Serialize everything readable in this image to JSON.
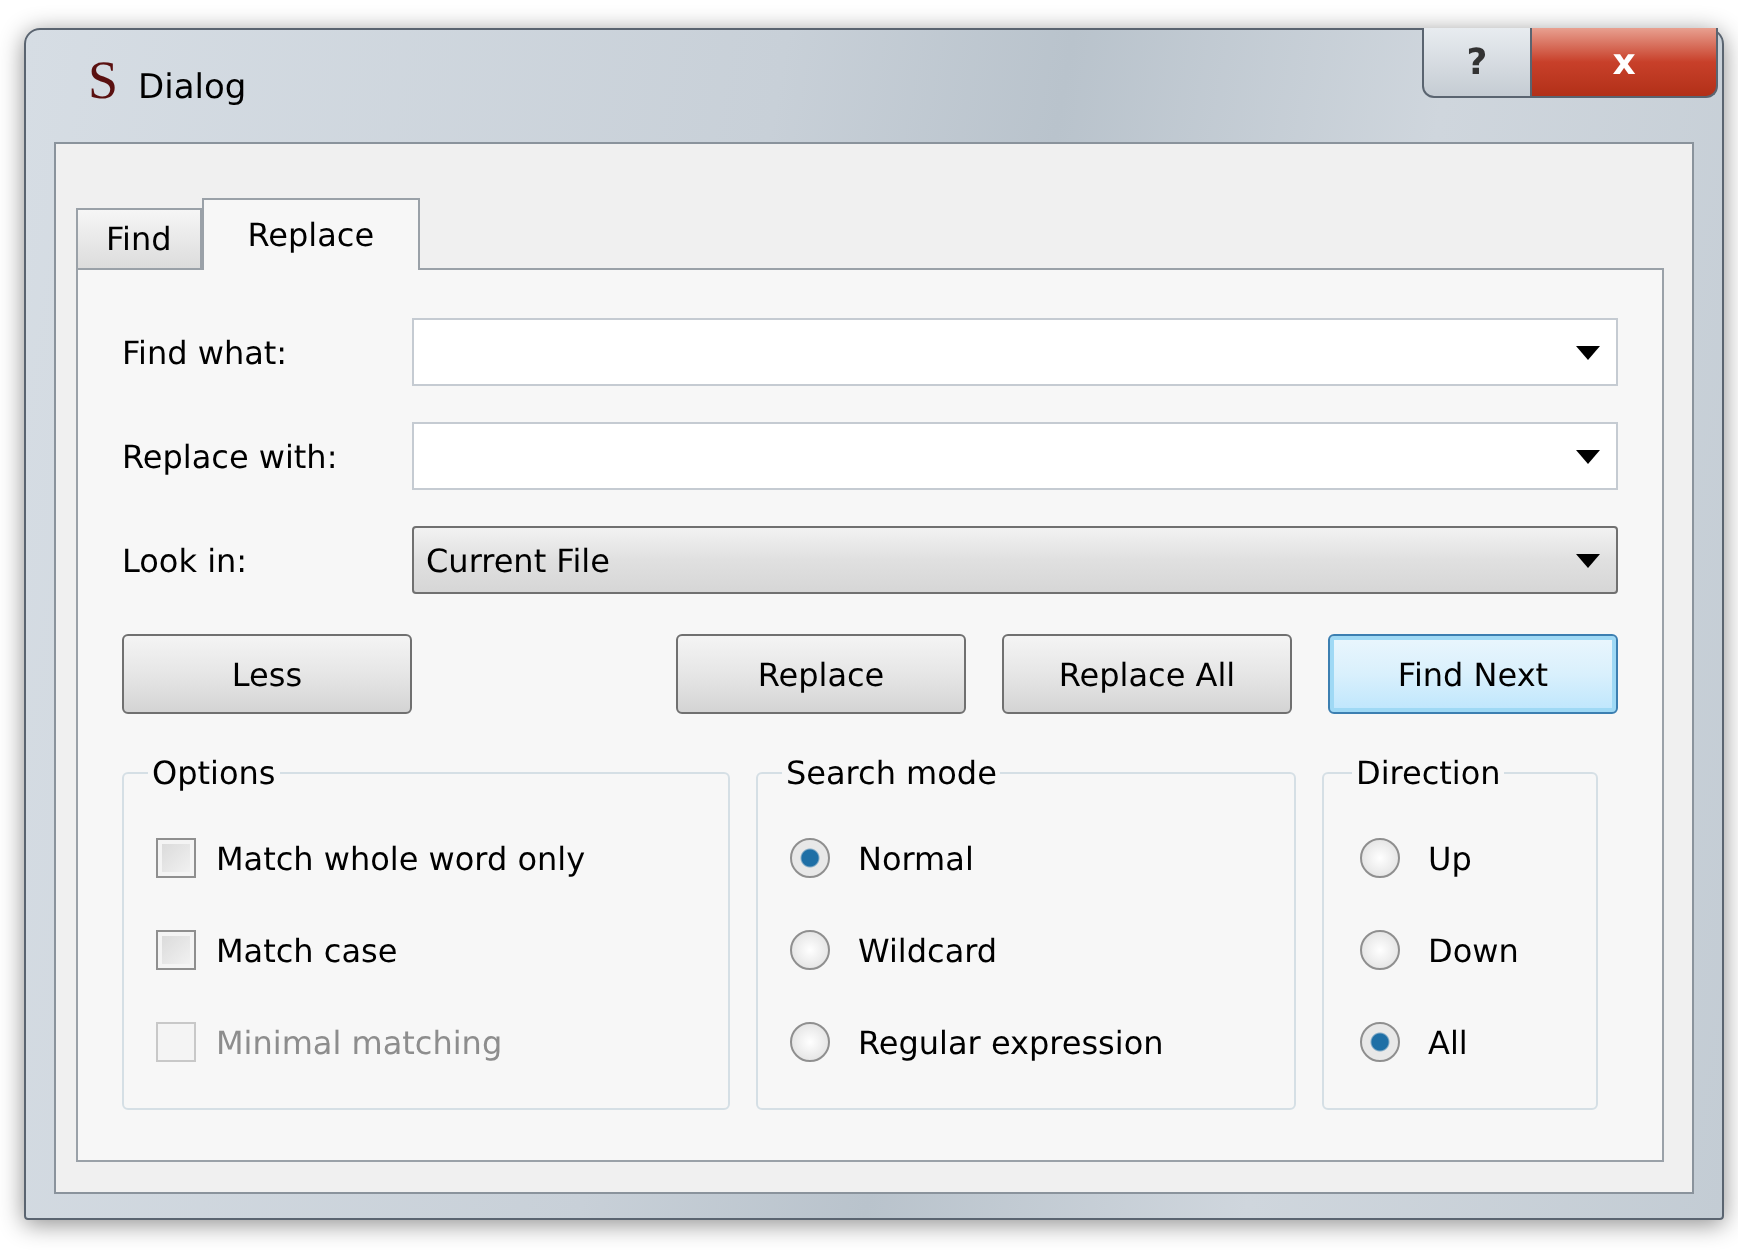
{
  "window": {
    "app_icon": "S",
    "title": "Dialog",
    "help_button": "?",
    "close_button": "x"
  },
  "tabs": [
    {
      "label": "Find",
      "selected": false
    },
    {
      "label": "Replace",
      "selected": true
    }
  ],
  "fields": [
    {
      "kind": "combo",
      "label": "Find what:"
    },
    {
      "kind": "combo",
      "label": "Replace with:"
    },
    {
      "kind": "select",
      "label": "Look in:",
      "value": "Current File"
    }
  ],
  "left_buttons": [
    {
      "label": "Less",
      "default": false
    }
  ],
  "right_buttons": [
    {
      "label": "Replace",
      "default": false
    },
    {
      "label": "Replace All",
      "default": false
    },
    {
      "label": "Find Next",
      "default": true
    }
  ],
  "groups": [
    {
      "title": "Options",
      "items": [
        {
          "kind": "checkbox",
          "label": "Match whole word only",
          "checked": false,
          "disabled": false
        },
        {
          "kind": "checkbox",
          "label": "Match case",
          "checked": false,
          "disabled": false
        },
        {
          "kind": "checkbox",
          "label": "Minimal matching",
          "checked": false,
          "disabled": true
        }
      ]
    },
    {
      "title": "Search mode",
      "items": [
        {
          "kind": "radio",
          "label": "Normal",
          "selected": true
        },
        {
          "kind": "radio",
          "label": "Wildcard",
          "selected": false
        },
        {
          "kind": "radio",
          "label": "Regular expression",
          "selected": false
        }
      ]
    },
    {
      "title": "Direction",
      "items": [
        {
          "kind": "radio",
          "label": "Up",
          "selected": false
        },
        {
          "kind": "radio",
          "label": "Down",
          "selected": false
        },
        {
          "kind": "radio",
          "label": "All",
          "selected": true
        }
      ]
    }
  ]
}
